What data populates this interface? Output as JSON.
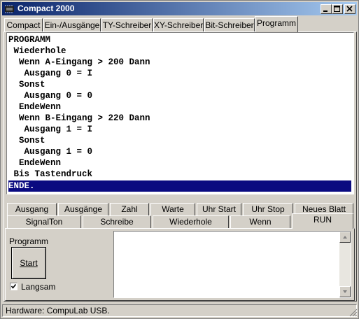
{
  "window": {
    "title": "Compact 2000"
  },
  "tabs": [
    "Compact",
    "Ein-/Ausgänge",
    "TY-Schreiber",
    "XY-Schreiber",
    "Bit-Schreiber",
    "Programm"
  ],
  "active_tab": "Programm",
  "program_lines": [
    "PROGRAMM",
    " Wiederhole",
    "  Wenn A-Eingang > 200 Dann",
    "   Ausgang 0 = I",
    "  Sonst",
    "   Ausgang 0 = 0",
    "  EndeWenn",
    "  Wenn B-Eingang > 220 Dann",
    "   Ausgang 1 = I",
    "  Sonst",
    "   Ausgang 1 = 0",
    "  EndeWenn",
    " Bis Tastendruck",
    "ENDE."
  ],
  "selected_line_text": "ENDE.",
  "command_tabs_row1": [
    "Ausgang",
    "Ausgänge",
    "Zahl",
    "Warte",
    "Uhr Start",
    "Uhr Stop",
    "Neues Blatt"
  ],
  "command_tabs_row2": [
    "SignalTon",
    "Schreibe",
    "Wiederhole",
    "Wenn",
    "RUN"
  ],
  "active_command_tab": "RUN",
  "run_panel": {
    "program_label": "Programm",
    "start_label": "Start",
    "slow_label": "Langsam",
    "slow_checked": true,
    "output_text": ""
  },
  "status": {
    "text": "Hardware: CompuLab USB."
  },
  "colors": {
    "title_start": "#0a246a",
    "title_end": "#a6caf0",
    "selection": "#0a0a80",
    "face": "#d4d0c8"
  }
}
